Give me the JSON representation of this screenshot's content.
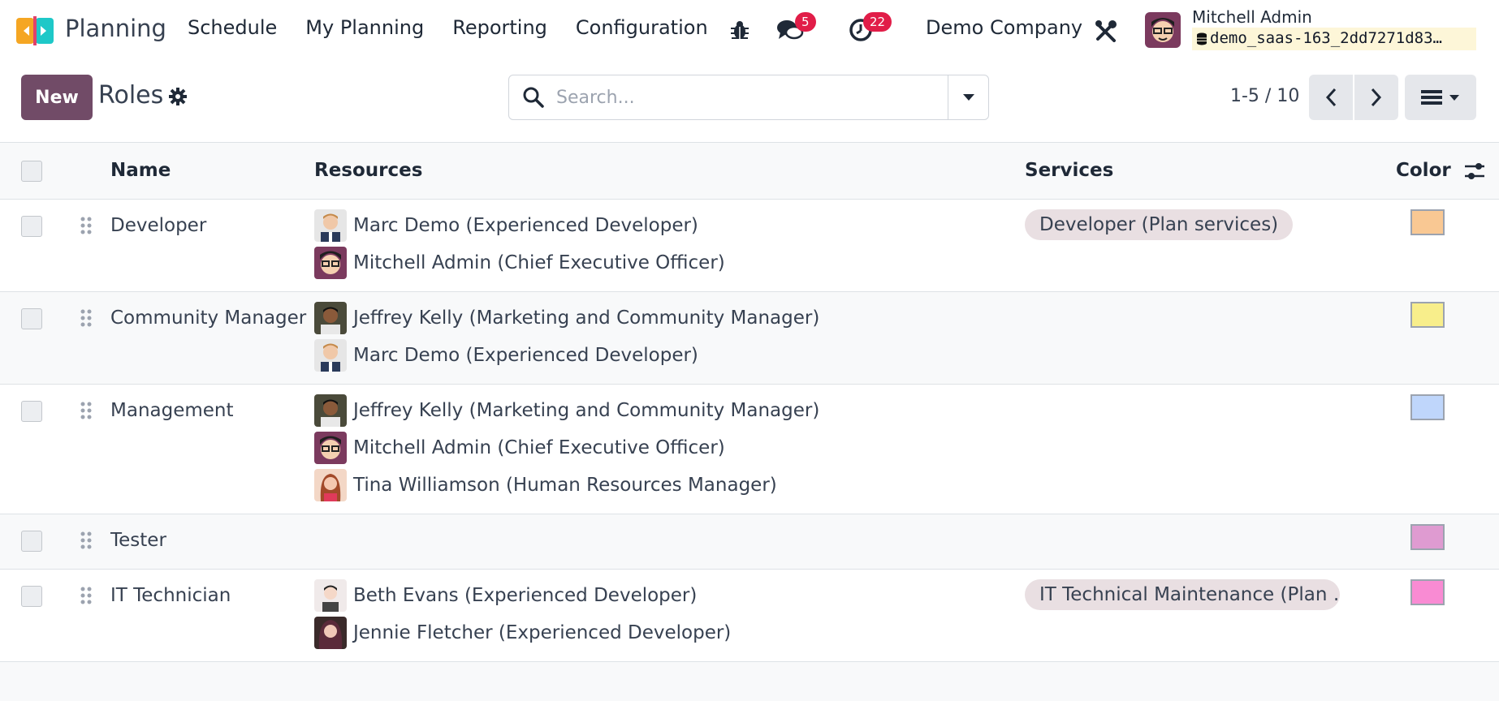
{
  "navbar": {
    "app_name": "Planning",
    "menu": [
      "Schedule",
      "My Planning",
      "Reporting",
      "Configuration"
    ],
    "messages_count": "5",
    "activities_count": "22",
    "company": "Demo Company",
    "user_name": "Mitchell Admin",
    "database": "demo_saas-163_2dd7271d83…"
  },
  "control": {
    "new_label": "New",
    "breadcrumb": "Roles",
    "search_placeholder": "Search...",
    "pager": "1-5 / 10"
  },
  "table": {
    "columns": {
      "name": "Name",
      "resources": "Resources",
      "services": "Services",
      "color": "Color"
    },
    "rows": [
      {
        "name": "Developer",
        "resources": [
          "Marc Demo (Experienced Developer)",
          "Mitchell Admin (Chief Executive Officer)"
        ],
        "services": [
          "Developer (Plan services)"
        ],
        "color": "#f9c893"
      },
      {
        "name": "Community Manager",
        "resources": [
          "Jeffrey Kelly (Marketing and Community Manager)",
          "Marc Demo (Experienced Developer)"
        ],
        "services": [],
        "color": "#f8ee8b"
      },
      {
        "name": "Management",
        "resources": [
          "Jeffrey Kelly (Marketing and Community Manager)",
          "Mitchell Admin (Chief Executive Officer)",
          "Tina Williamson (Human Resources Manager)"
        ],
        "services": [],
        "color": "#bfd6fb"
      },
      {
        "name": "Tester",
        "resources": [],
        "services": [],
        "color": "#df9bd1"
      },
      {
        "name": "IT Technician",
        "resources": [
          "Beth Evans (Experienced Developer)",
          "Jennie Fletcher (Experienced Developer)"
        ],
        "services": [
          "IT Technical Maintenance (Plan …"
        ],
        "color": "#f98bd3"
      }
    ]
  },
  "colors": {
    "brand": "#714b67",
    "badge": "#e11d48",
    "tag_bg": "#e9dfe2"
  }
}
